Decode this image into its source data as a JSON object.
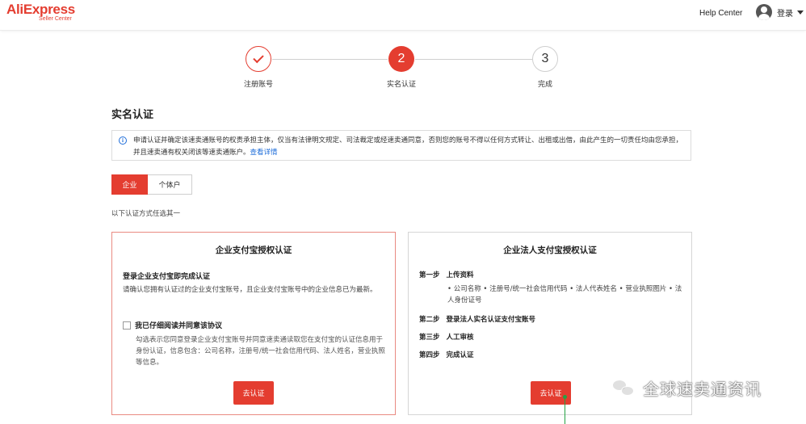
{
  "header": {
    "logo_main_a": "Ali",
    "logo_main_b": "Express",
    "logo_sub": "Seller Center",
    "help": "Help Center",
    "login": "登录"
  },
  "stepper": {
    "steps": [
      {
        "label": "注册账号",
        "state": "done"
      },
      {
        "label": "实名认证",
        "number": "2",
        "state": "active"
      },
      {
        "label": "完成",
        "number": "3",
        "state": "todo"
      }
    ]
  },
  "page": {
    "title": "实名认证",
    "notice_text": "申请认证并确定该速卖通账号的权责承担主体，仅当有法律明文规定、司法裁定或经速卖通同意，否则您的账号不得以任何方式转让、出租或出借，由此产生的一切责任均由您承担，并且速卖通有权关闭该等速卖通账户。",
    "notice_link": "查看详情",
    "tabs": [
      "企业",
      "个体户"
    ],
    "choose_text": "以下认证方式任选其一"
  },
  "left_card": {
    "title": "企业支付宝授权认证",
    "subtitle": "登录企业支付宝即完成认证",
    "desc": "请确认您拥有认证过的企业支付宝账号，且企业支付宝账号中的企业信息已为最新。",
    "checkbox_label": "我已仔细阅读并同意该协议",
    "agree_text": "勾选表示您同意登录企业支付宝账号并同意速卖通读取您在支付宝的认证信息用于身份认证，信息包含：公司名称，注册号/统一社会信用代码、法人姓名，营业执照等信息。",
    "button": "去认证"
  },
  "right_card": {
    "title": "企业法人支付宝授权认证",
    "steps": [
      {
        "num": "第一步",
        "text": "上传资料"
      },
      {
        "num": "第二步",
        "text": "登录法人实名认证支付宝账号"
      },
      {
        "num": "第三步",
        "text": "人工审核"
      },
      {
        "num": "第四步",
        "text": "完成认证"
      }
    ],
    "items_text": "• 公司名称  • 注册号/统一社会信用代码  • 法人代表姓名  • 营业执照图片  • 法人身份证号",
    "button": "去认证"
  },
  "watermark": {
    "text": "全球速卖通资讯"
  },
  "colors": {
    "accent": "#e43d30",
    "link": "#1e6dd9",
    "guide": "#25a244"
  }
}
